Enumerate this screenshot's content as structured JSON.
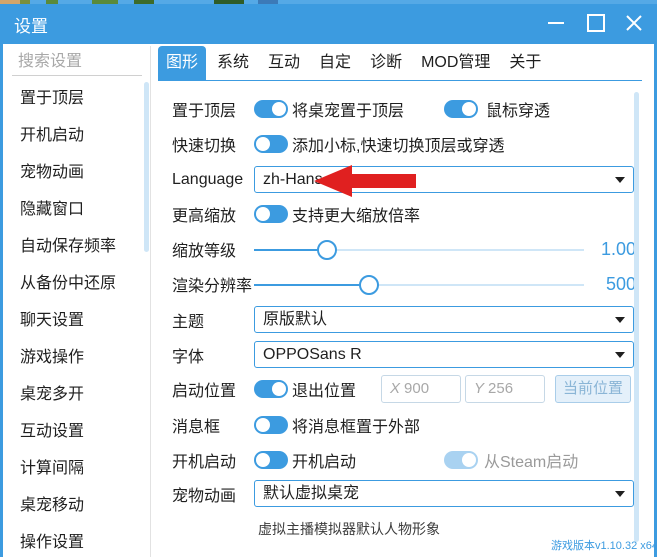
{
  "window": {
    "title": "设置"
  },
  "sidebar": {
    "search_placeholder": "搜索设置",
    "items": [
      {
        "label": "置于顶层"
      },
      {
        "label": "开机启动"
      },
      {
        "label": "宠物动画"
      },
      {
        "label": "隐藏窗口"
      },
      {
        "label": "自动保存频率"
      },
      {
        "label": "从备份中还原"
      },
      {
        "label": "聊天设置"
      },
      {
        "label": "游戏操作"
      },
      {
        "label": "桌宠多开"
      },
      {
        "label": "互动设置"
      },
      {
        "label": "计算间隔"
      },
      {
        "label": "桌宠移动"
      },
      {
        "label": "操作设置"
      }
    ]
  },
  "tabs": [
    {
      "label": "图形",
      "active": true
    },
    {
      "label": "系统"
    },
    {
      "label": "互动"
    },
    {
      "label": "自定"
    },
    {
      "label": "诊断"
    },
    {
      "label": "MOD管理"
    },
    {
      "label": "关于"
    }
  ],
  "settings": {
    "topmost": {
      "label": "置于顶层",
      "toggle_text": "将桌宠置于顶层",
      "on": true,
      "mouse_through_text": "鼠标穿透",
      "mouse_through_on": true
    },
    "quick_switch": {
      "label": "快速切换",
      "toggle_text": "添加小标,快速切换顶层或穿透",
      "on": false
    },
    "language": {
      "label": "Language",
      "value": "zh-Hans"
    },
    "higher_zoom": {
      "label": "更高缩放",
      "toggle_text": "支持更大缩放倍率",
      "on": false
    },
    "zoom_level": {
      "label": "缩放等级",
      "value_text": "1.00",
      "fraction": 0.22
    },
    "render_resolution": {
      "label": "渲染分辨率",
      "value_text": "500",
      "fraction": 0.35
    },
    "theme": {
      "label": "主题",
      "value": "原版默认"
    },
    "font": {
      "label": "字体",
      "value": "OPPOSans R"
    },
    "start_position": {
      "label": "启动位置",
      "toggle_text": "退出位置",
      "on": true,
      "x_axis": "X",
      "x_placeholder": "900",
      "y_axis": "Y",
      "y_placeholder": "256",
      "current_button": "当前位置"
    },
    "message_box": {
      "label": "消息框",
      "toggle_text": "将消息框置于外部",
      "on": false
    },
    "autostart": {
      "label": "开机启动",
      "toggle_text": "开机启动",
      "on": false,
      "steam_text": "从Steam启动",
      "steam_on": true
    },
    "pet_animation": {
      "label": "宠物动画",
      "value": "默认虚拟桌宠"
    },
    "partial_text": "虚拟主播模拟器默认人物形象"
  },
  "footer": {
    "version": "游戏版本v1.10.32 x64"
  },
  "colors": {
    "accent": "#3c9be0",
    "arrow": "#e02020"
  }
}
